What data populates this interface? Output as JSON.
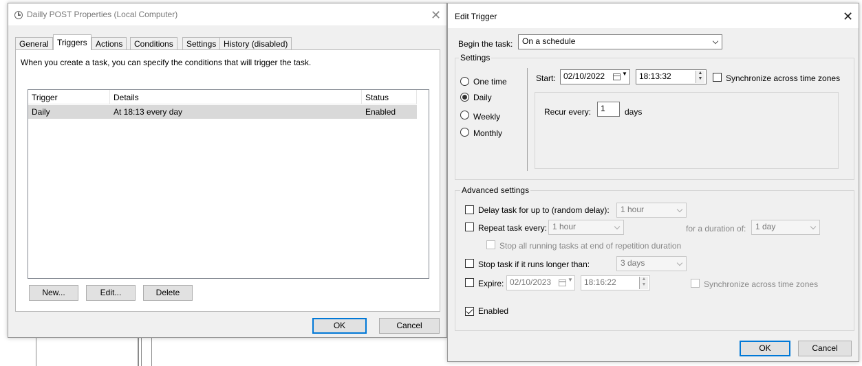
{
  "background": {},
  "left_dialog": {
    "title": "Dailly POST Properties (Local Computer)",
    "close_glyph": "✕",
    "tabs": [
      "General",
      "Triggers",
      "Actions",
      "Conditions",
      "Settings",
      "History (disabled)"
    ],
    "active_tab": "Triggers",
    "description": "When you create a task, you can specify the conditions that will trigger the task.",
    "table": {
      "columns": [
        "Trigger",
        "Details",
        "Status"
      ],
      "rows": [
        {
          "trigger": "Daily",
          "details": "At 18:13 every day",
          "status": "Enabled"
        }
      ]
    },
    "buttons": {
      "new": "New...",
      "edit": "Edit...",
      "delete": "Delete",
      "ok": "OK",
      "cancel": "Cancel"
    }
  },
  "right_dialog": {
    "title": "Edit Trigger",
    "close_glyph": "✕",
    "begin_label": "Begin the task:",
    "begin_value": "On a schedule",
    "settings_group": "Settings",
    "radios": [
      "One time",
      "Daily",
      "Weekly",
      "Monthly"
    ],
    "selected_radio": "Daily",
    "start_label": "Start:",
    "start_date": "02/10/2022",
    "start_time": "18:13:32",
    "sync_label": "Synchronize across time zones",
    "recur_label": "Recur every:",
    "recur_value": "1",
    "recur_unit": "days",
    "advanced_group": "Advanced settings",
    "delay_label": "Delay task for up to (random delay):",
    "delay_value": "1 hour",
    "repeat_label": "Repeat task every:",
    "repeat_value": "1 hour",
    "duration_label": "for a duration of:",
    "duration_value": "1 day",
    "stop_all_label": "Stop all running tasks at end of repetition duration",
    "stop_if_label": "Stop task if it runs longer than:",
    "stop_if_value": "3 days",
    "expire_label": "Expire:",
    "expire_date": "02/10/2023",
    "expire_time": "18:16:22",
    "expire_sync_label": "Synchronize across time zones",
    "enabled_label": "Enabled",
    "ok": "OK",
    "cancel": "Cancel"
  }
}
